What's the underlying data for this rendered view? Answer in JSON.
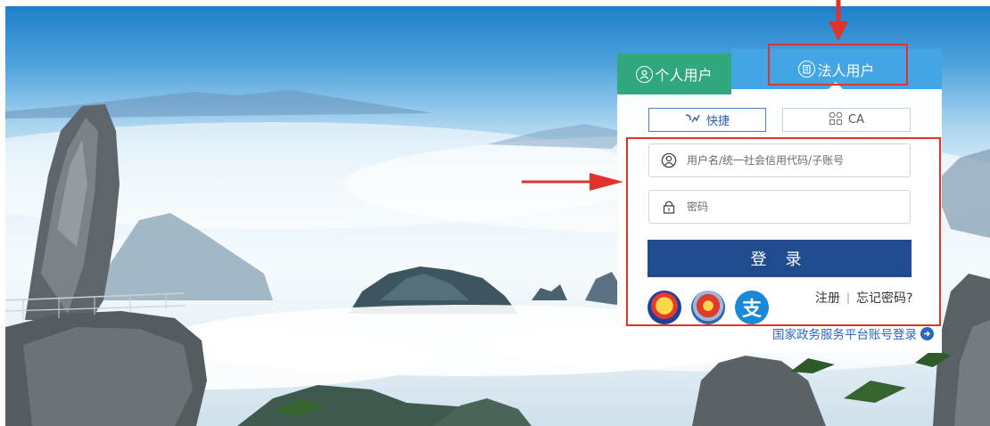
{
  "tabs": {
    "personal_label": "个人用户",
    "corporate_label": "法人用户",
    "active": "corporate"
  },
  "login_modes": {
    "quick_label": "快捷",
    "ca_label": "CA",
    "active": "quick"
  },
  "form": {
    "username_placeholder": "用户名/统一社会信用代码/子账号",
    "username_value": "",
    "password_placeholder": "密码",
    "password_value": "",
    "submit_label": "登 录"
  },
  "third_party": {
    "alipay_glyph": "支"
  },
  "links": {
    "register_label": "注册",
    "separator": "|",
    "forgot_label": "忘记密码?"
  },
  "gov_service_link": "国家政务服务平台账号登录",
  "icons": {
    "personal_tab": "user-circle-icon",
    "corporate_tab": "building-icon",
    "quick": "quick-login-icon",
    "ca": "ca-certificate-icon",
    "username": "user-icon",
    "password": "lock-icon",
    "gov_link": "arrow-right-circle-icon"
  },
  "colors": {
    "personal_tab": "#31a77d",
    "corporate_tab": "#43a5e4",
    "submit_button": "#1e4c8f",
    "link_blue": "#2a66c4",
    "annotation_red": "#e0332c"
  }
}
